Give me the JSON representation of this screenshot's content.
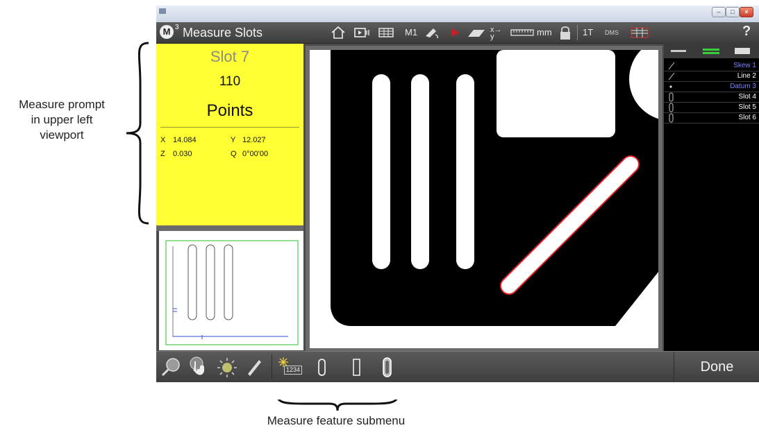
{
  "annotations": {
    "prompt_note": [
      "Measure prompt",
      "in upper left",
      "viewport"
    ],
    "submenu_note": "Measure feature submenu"
  },
  "app": {
    "title": "Measure Slots",
    "logo_letter": "M",
    "logo_sup": "3"
  },
  "toolbar": {
    "home_icon": "home-icon",
    "camera_icon": "video-camera-icon",
    "grid_icon": "table-grid-icon",
    "mode_label": "M1",
    "probe_icon": "probe-icon",
    "play_icon": "play-icon",
    "plane_icon": "plane-icon",
    "axis_icon": "xy-axis-icon",
    "ruler_icon": "ruler-icon",
    "units_label": "mm",
    "lock_icon": "lock-icon",
    "tolerance_label": "1T",
    "angle_label": "DMS",
    "table_icon": "data-table-icon",
    "help_label": "?"
  },
  "prompt": {
    "feature": "Slot 7",
    "count": "110",
    "unit": "Points",
    "coords": [
      {
        "axis": "X",
        "value": "14.084"
      },
      {
        "axis": "Y",
        "value": "12.027"
      },
      {
        "axis": "Z",
        "value": "0.030"
      },
      {
        "axis": "Q",
        "value": "0°00'00"
      }
    ]
  },
  "feature_list": [
    {
      "icon": "line-icon",
      "label": "Skew 1",
      "color": "#7f7fff"
    },
    {
      "icon": "line-icon",
      "label": "Line 2",
      "color": "#ffffff"
    },
    {
      "icon": "point-icon",
      "label": "Datum 3",
      "color": "#7f7fff"
    },
    {
      "icon": "slot-icon",
      "label": "Slot 4",
      "color": "#ffffff"
    },
    {
      "icon": "slot-icon",
      "label": "Slot 5",
      "color": "#ffffff"
    },
    {
      "icon": "slot-icon",
      "label": "Slot 6",
      "color": "#ffffff"
    }
  ],
  "bottombar": {
    "tools": [
      "magnifier-icon",
      "touch-probe-icon",
      "light-icon",
      "pen-icon"
    ],
    "submenu": [
      "auto-measure-icon",
      "slot-icon",
      "rectangle-slot-icon",
      "arc-slot-icon"
    ],
    "auto_badge": "1234",
    "done_label": "Done"
  },
  "colors": {
    "prompt_bg": "#ffff33",
    "highlight_red": "#e0242a"
  }
}
